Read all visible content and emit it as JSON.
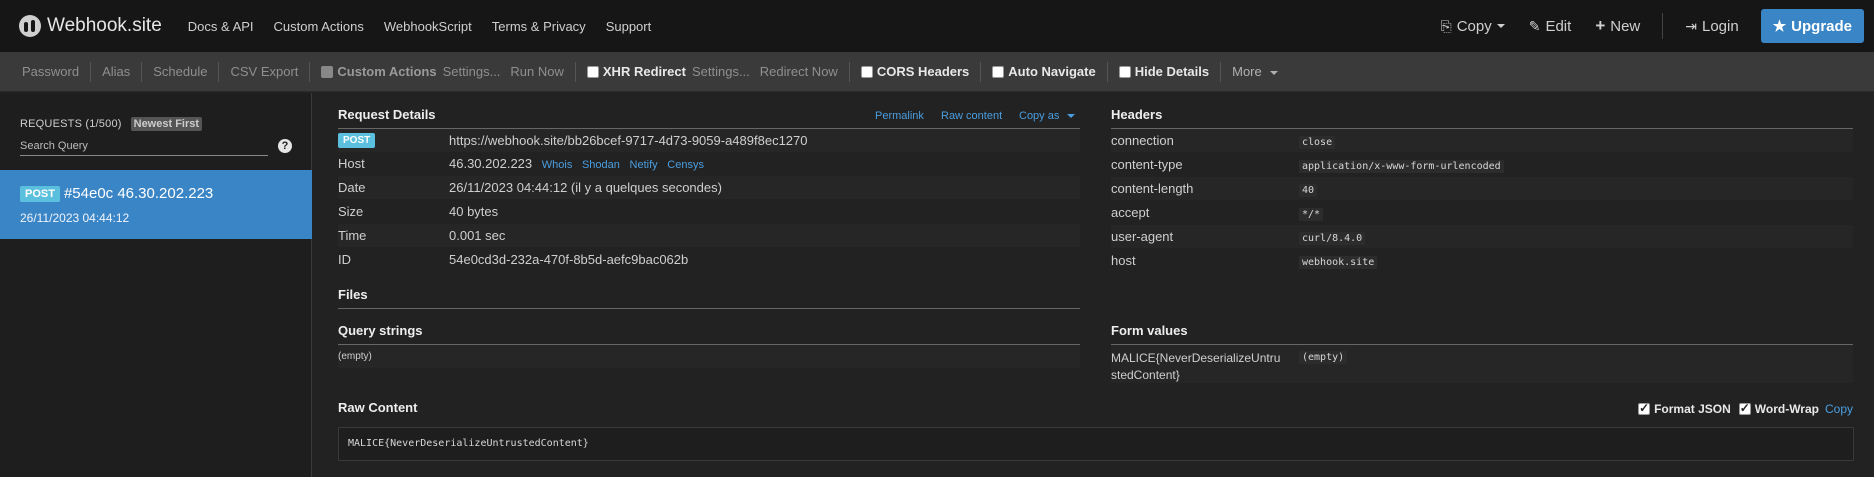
{
  "navbar": {
    "brand": "Webhook.site",
    "links": [
      "Docs & API",
      "Custom Actions",
      "WebhookScript",
      "Terms & Privacy",
      "Support"
    ],
    "copy": "Copy",
    "edit": "Edit",
    "new": "New",
    "login": "Login",
    "upgrade": "Upgrade"
  },
  "toolbar": {
    "password": "Password",
    "alias": "Alias",
    "schedule": "Schedule",
    "csv_export": "CSV Export",
    "custom_actions": "Custom Actions",
    "custom_actions_settings": "Settings...",
    "run_now": "Run Now",
    "xhr_redirect": "XHR Redirect",
    "xhr_settings": "Settings...",
    "redirect_now": "Redirect Now",
    "cors_headers": "CORS Headers",
    "auto_navigate": "Auto Navigate",
    "hide_details": "Hide Details",
    "more": "More"
  },
  "sidebar": {
    "requests_label": "REQUESTS (1/500)",
    "sort_label": "Newest First",
    "search_placeholder": "Search Query",
    "requests": [
      {
        "method": "POST",
        "title": "#54e0c 46.30.202.223",
        "date": "26/11/2023 04:44:12"
      }
    ]
  },
  "request_details": {
    "title": "Request Details",
    "permalink": "Permalink",
    "raw_content_link": "Raw content",
    "copy_as": "Copy as",
    "method": "POST",
    "url": "https://webhook.site/bb26bcef-9717-4d73-9059-a489f8ec1270",
    "host_label": "Host",
    "host": "46.30.202.223",
    "host_links": [
      "Whois",
      "Shodan",
      "Netify",
      "Censys"
    ],
    "date_label": "Date",
    "date": "26/11/2023 04:44:12 (il y a quelques secondes)",
    "size_label": "Size",
    "size": "40 bytes",
    "time_label": "Time",
    "time": "0.001 sec",
    "id_label": "ID",
    "id": "54e0cd3d-232a-470f-8b5d-aefc9bac062b"
  },
  "headers": {
    "title": "Headers",
    "rows": [
      {
        "key": "connection",
        "value": "close"
      },
      {
        "key": "content-type",
        "value": "application/x-www-form-urlencoded"
      },
      {
        "key": "content-length",
        "value": "40"
      },
      {
        "key": "accept",
        "value": "*/*"
      },
      {
        "key": "user-agent",
        "value": "curl/8.4.0"
      },
      {
        "key": "host",
        "value": "webhook.site"
      }
    ]
  },
  "files": {
    "title": "Files"
  },
  "query_strings": {
    "title": "Query strings",
    "value": "(empty)"
  },
  "form_values": {
    "title": "Form values",
    "key_line1": "MALICE{NeverDeserializeUntru",
    "key_line2": "stedContent}",
    "value": "(empty)"
  },
  "raw_content": {
    "title": "Raw Content",
    "format_json": "Format JSON",
    "word_wrap": "Word-Wrap",
    "copy": "Copy",
    "body": "MALICE{NeverDeserializeUntrustedContent}"
  },
  "colors": {
    "accent": "#3a85c6",
    "post_badge": "#5bc0de",
    "link": "#4a9ee0"
  }
}
